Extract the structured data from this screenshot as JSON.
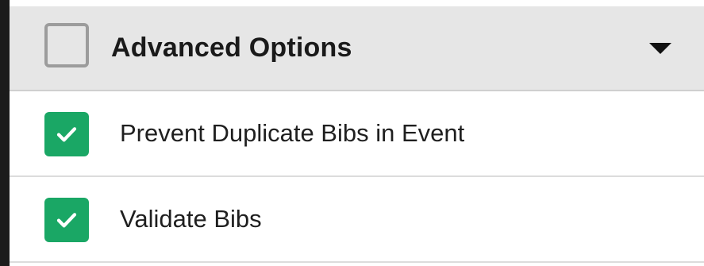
{
  "section": {
    "title": "Advanced Options",
    "checked": false,
    "expanded": true,
    "caret_icon": "caret-down-icon"
  },
  "options": [
    {
      "label": "Prevent Duplicate Bibs in Event",
      "checked": true
    },
    {
      "label": "Validate Bibs",
      "checked": true
    }
  ],
  "colors": {
    "header_bg": "#e6e6e6",
    "checked_bg": "#1aa765",
    "unchecked_border": "#9c9c9c",
    "left_edge": "#1b1b1b"
  }
}
